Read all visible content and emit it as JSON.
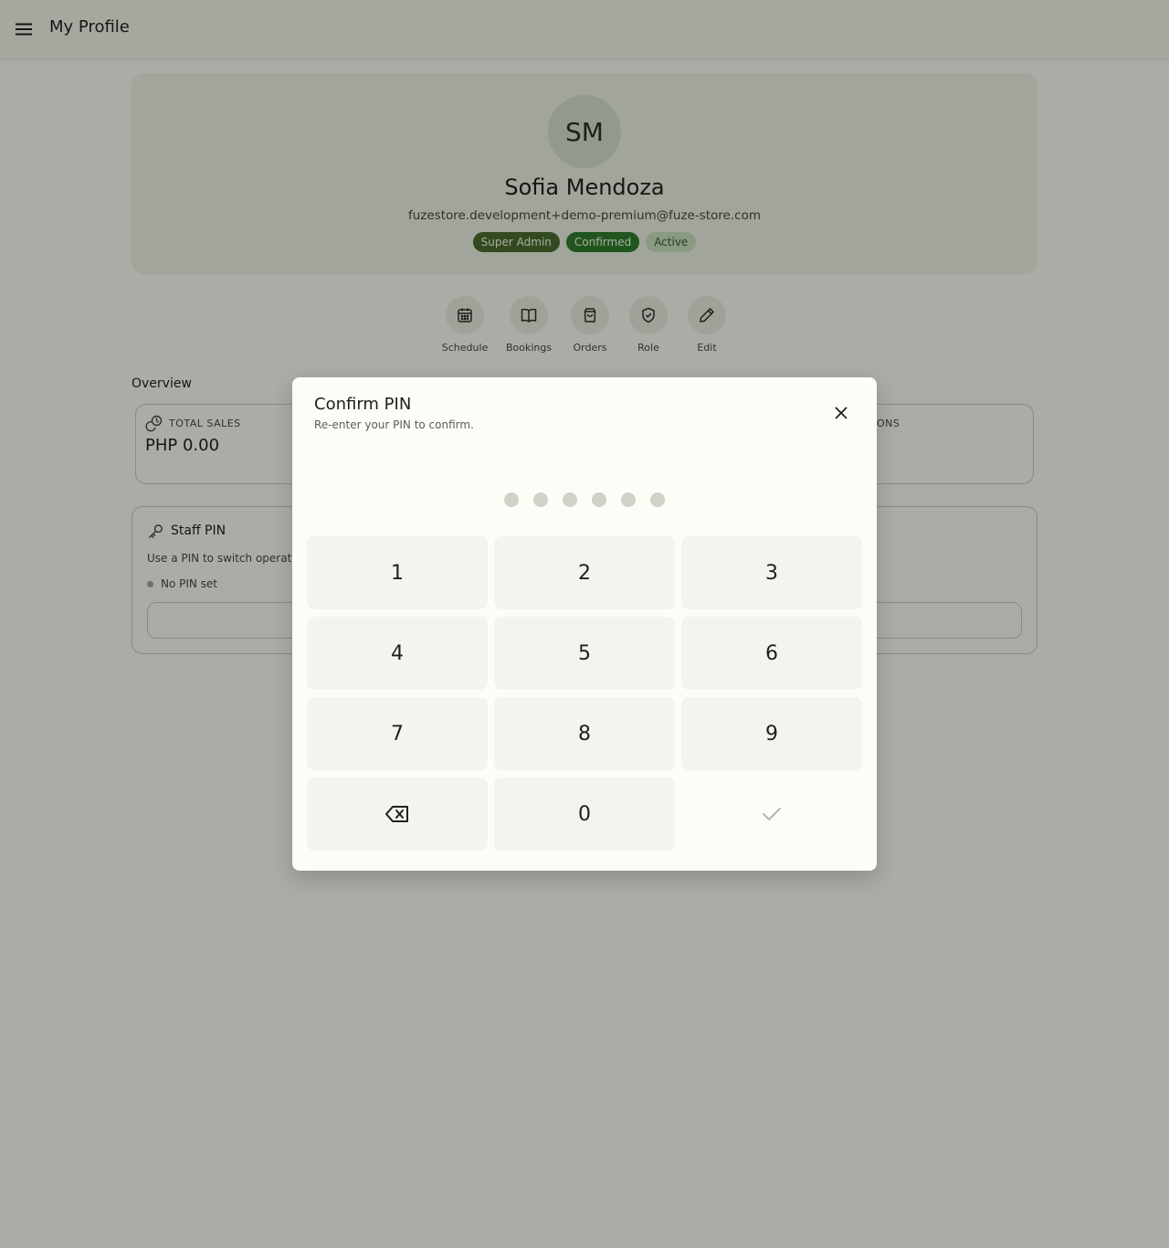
{
  "app_bar": {
    "title": "My Profile",
    "menu_icon": "menu-icon"
  },
  "profile": {
    "initials": "SM",
    "name": "Sofia Mendoza",
    "email": "fuzestore.development+demo-premium@fuze-store.com",
    "badges": [
      "Super Admin",
      "Confirmed",
      "Active"
    ]
  },
  "actions": [
    {
      "label": "Schedule",
      "icon": "calendar-icon"
    },
    {
      "label": "Bookings",
      "icon": "book-icon"
    },
    {
      "label": "Orders",
      "icon": "shopping-bag-icon"
    },
    {
      "label": "Role",
      "icon": "shield-check-icon"
    },
    {
      "label": "Edit",
      "icon": "pencil-icon"
    }
  ],
  "overview": {
    "title": "Overview",
    "total_sales_label": "TOTAL SALES",
    "total_sales_value": "PHP 0.00",
    "right_label_partial": "ONS"
  },
  "staff_pin": {
    "title": "Staff PIN",
    "description": "Use a PIN to switch operators",
    "status": "No PIN set"
  },
  "dialog": {
    "title": "Confirm PIN",
    "subtitle": "Re-enter your PIN to confirm.",
    "pin_length": 6,
    "pin_filled": 0,
    "keys": [
      "1",
      "2",
      "3",
      "4",
      "5",
      "6",
      "7",
      "8",
      "9",
      "0"
    ]
  },
  "colors": {
    "background": "#f4f6ee",
    "badge_super_admin": "#4a6b2f",
    "badge_confirmed": "#2f7a2b",
    "badge_active": "#c6dcbb",
    "dialog_surface": "#fdfdf8",
    "key_surface": "#f3f4ee"
  }
}
